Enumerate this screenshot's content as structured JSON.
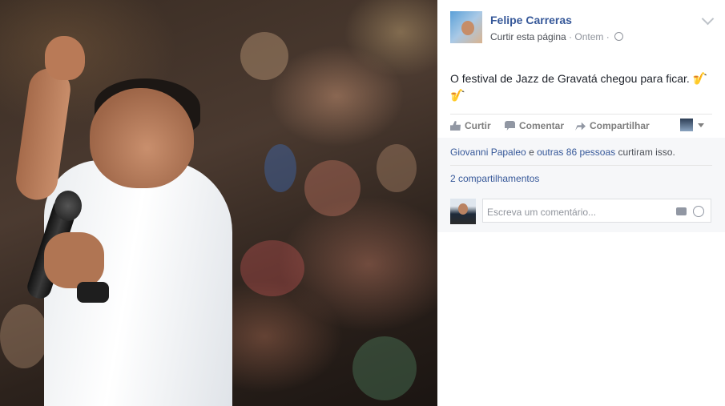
{
  "post": {
    "author": "Felipe Carreras",
    "like_page": "Curtir esta página",
    "sep1": " · ",
    "time": "Ontem",
    "sep2": " · ",
    "text": "O festival de Jazz de Gravatá chegou para ficar.",
    "emoji": "🎷"
  },
  "actions": {
    "like": "Curtir",
    "comment": "Comentar",
    "share": "Compartilhar"
  },
  "reactions": {
    "name": "Giovanni Papaleo",
    "joiner": " e ",
    "others": "outras 86 pessoas",
    "suffix": " curtiram isso."
  },
  "shares": "2 compartilhamentos",
  "comment_box": {
    "placeholder": "Escreva um comentário..."
  },
  "icons": [
    "globe-icon",
    "chevron-down-icon",
    "like-icon",
    "comment-icon",
    "share-icon",
    "camera-icon",
    "emoji-icon"
  ],
  "colors": {
    "link": "#365899",
    "muted": "#90949c",
    "panel_gray": "#f6f7f9"
  }
}
